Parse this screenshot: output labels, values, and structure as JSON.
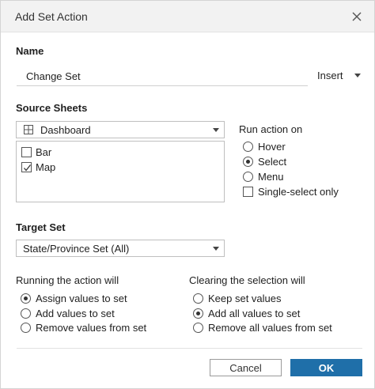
{
  "dialog": {
    "title": "Add Set Action"
  },
  "name_section": {
    "label": "Name",
    "value": "Change Set",
    "insert_label": "Insert"
  },
  "source_sheets": {
    "label": "Source Sheets",
    "dropdown_value": "Dashboard",
    "sheets": [
      {
        "label": "Bar",
        "checked": false
      },
      {
        "label": "Map",
        "checked": true
      }
    ]
  },
  "run_action_on": {
    "label": "Run action on",
    "options": [
      {
        "label": "Hover",
        "selected": false
      },
      {
        "label": "Select",
        "selected": true
      },
      {
        "label": "Menu",
        "selected": false
      }
    ],
    "single_select_label": "Single-select only",
    "single_select_checked": false
  },
  "target_set": {
    "label": "Target Set",
    "value": "State/Province Set (All)"
  },
  "running_action": {
    "label": "Running the action will",
    "options": [
      {
        "label": "Assign values to set",
        "selected": true
      },
      {
        "label": "Add values to set",
        "selected": false
      },
      {
        "label": "Remove values from set",
        "selected": false
      }
    ]
  },
  "clearing_selection": {
    "label": "Clearing the selection will",
    "options": [
      {
        "label": "Keep set values",
        "selected": false
      },
      {
        "label": "Add all values to set",
        "selected": true
      },
      {
        "label": "Remove all values from set",
        "selected": false
      }
    ]
  },
  "buttons": {
    "cancel": "Cancel",
    "ok": "OK"
  }
}
